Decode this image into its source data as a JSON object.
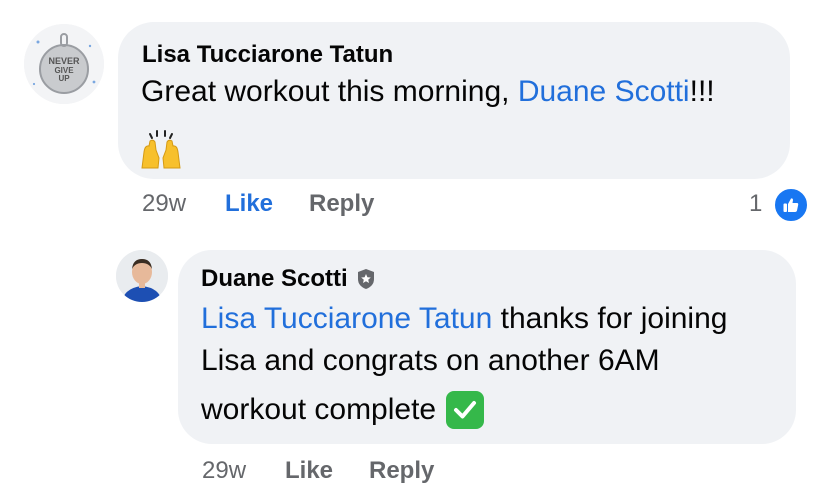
{
  "comments": [
    {
      "author": "Lisa Tucciarone Tatun",
      "avatar": {
        "name": "never-give-up-avatar",
        "badge_text": "NEVER GIVE UP"
      },
      "text_before": "Great workout this morning, ",
      "mention": "Duane Scotti",
      "text_after": "!!!",
      "emoji": "🙌",
      "time": "29w",
      "like_label": "Like",
      "reply_label": "Reply",
      "reaction_count": "1",
      "reaction_icon": "thumbs-up-icon",
      "like_active": true
    },
    {
      "author": "Duane Scotti",
      "author_badge_icon": "shield-star-icon",
      "avatar": {
        "name": "profile-photo-avatar"
      },
      "mention": "Lisa Tucciarone Tatun",
      "line1_after_mention": " thanks for joining",
      "line2": "Lisa and congrats on another 6AM",
      "line3": "workout complete",
      "emoji": "check-mark-button-icon",
      "time": "29w",
      "like_label": "Like",
      "reply_label": "Reply",
      "like_active": false
    }
  ],
  "colors": {
    "bubble": "#f0f2f5",
    "mention": "#216fdb",
    "meta_text": "#65676b",
    "like_badge": "#1877f2",
    "check_green": "#35b84a"
  }
}
